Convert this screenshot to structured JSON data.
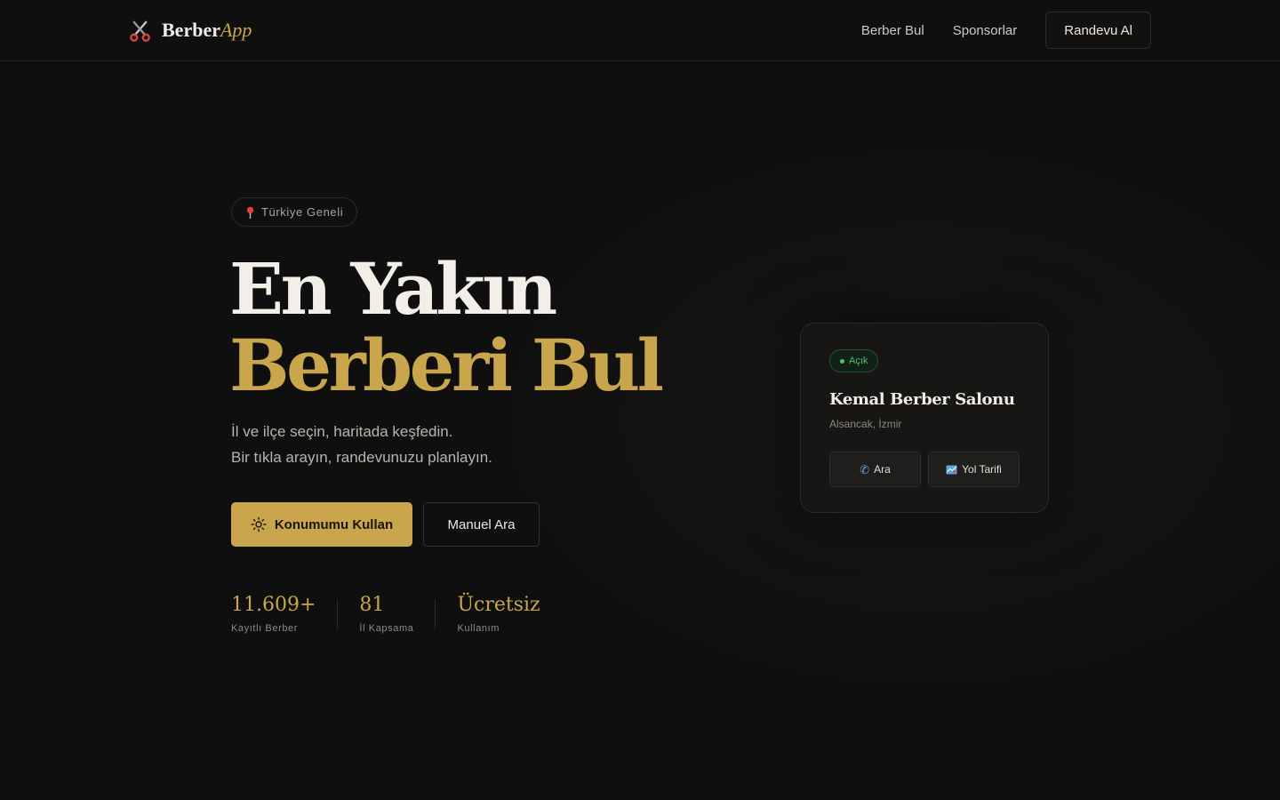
{
  "header": {
    "logo_main": "Berber",
    "logo_accent": "App",
    "nav": [
      "Berber Bul",
      "Sponsorlar"
    ],
    "cta": "Randevu Al"
  },
  "hero": {
    "badge": "Türkiye Geneli",
    "title_line1": "En Yakın",
    "title_line2": "Berberi Bul",
    "subtitle_line1": "İl ve ilçe seçin, haritada keşfedin.",
    "subtitle_line2": "Bir tıkla arayın, randevunuzu planlayın.",
    "primary_button": "Konumumu Kullan",
    "secondary_button": "Manuel Ara"
  },
  "stats": [
    {
      "value": "11.609+",
      "label": "Kayıtlı Berber"
    },
    {
      "value": "81",
      "label": "İl Kapsama"
    },
    {
      "value": "Ücretsiz",
      "label": "Kullanım"
    }
  ],
  "card": {
    "status": "Açık",
    "name": "Kemal Berber Salonu",
    "location": "Alsancak, İzmir",
    "call_button": "Ara",
    "route_button": "Yol Tarifi"
  },
  "colors": {
    "background": "#100f0f",
    "accent_gold": "#c9a54c",
    "open_green": "#4fbf72",
    "text_light": "#f1ede6"
  },
  "icons": {
    "logo": "scissors-icon",
    "badge": "map-pin-icon",
    "primary_button": "sun-icon",
    "status": "green-dot-icon",
    "call": "phone-icon",
    "route": "map-icon"
  }
}
